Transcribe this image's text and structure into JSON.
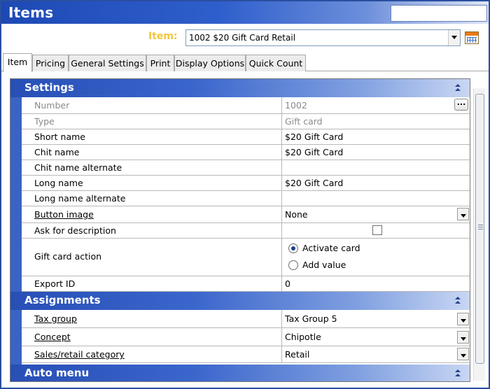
{
  "window": {
    "title": "Items"
  },
  "item_selector": {
    "label": "Item:",
    "value": "1002 $20 Gift Card Retail",
    "icon": "calendar-icon"
  },
  "tabs": [
    {
      "label": "Item",
      "active": true
    },
    {
      "label": "Pricing",
      "active": false
    },
    {
      "label": "General Settings",
      "active": false
    },
    {
      "label": "Print",
      "active": false
    },
    {
      "label": "Display Options",
      "active": false
    },
    {
      "label": "Quick Count",
      "active": false
    }
  ],
  "sections": {
    "settings": {
      "title": "Settings",
      "rows": [
        {
          "label": "Number",
          "value": "1002"
        },
        {
          "label": "Type",
          "value": "Gift card"
        },
        {
          "label": "Short name",
          "value": "$20 Gift Card"
        },
        {
          "label": "Chit name",
          "value": "$20 Gift Card"
        },
        {
          "label": "Chit name alternate",
          "value": ""
        },
        {
          "label": "Long name",
          "value": "$20 Gift Card"
        },
        {
          "label": "Long name alternate",
          "value": ""
        },
        {
          "label": "Button image",
          "value": "None"
        },
        {
          "label": "Ask for description",
          "checked": false
        },
        {
          "label": "Gift card action",
          "options": [
            "Activate card",
            "Add value"
          ],
          "selected": "Activate card"
        },
        {
          "label": "Export ID",
          "value": "0"
        }
      ]
    },
    "assignments": {
      "title": "Assignments",
      "rows": [
        {
          "label": "Tax group",
          "value": "Tax Group 5"
        },
        {
          "label": "Concept",
          "value": "Chipotle"
        },
        {
          "label": "Sales/retail category",
          "value": "Retail"
        }
      ]
    },
    "auto_menu": {
      "title": "Auto menu"
    }
  },
  "colors": {
    "title_blue": "#1d49b4",
    "section_blue": "#274fb6",
    "item_label": "#f4c63b"
  }
}
